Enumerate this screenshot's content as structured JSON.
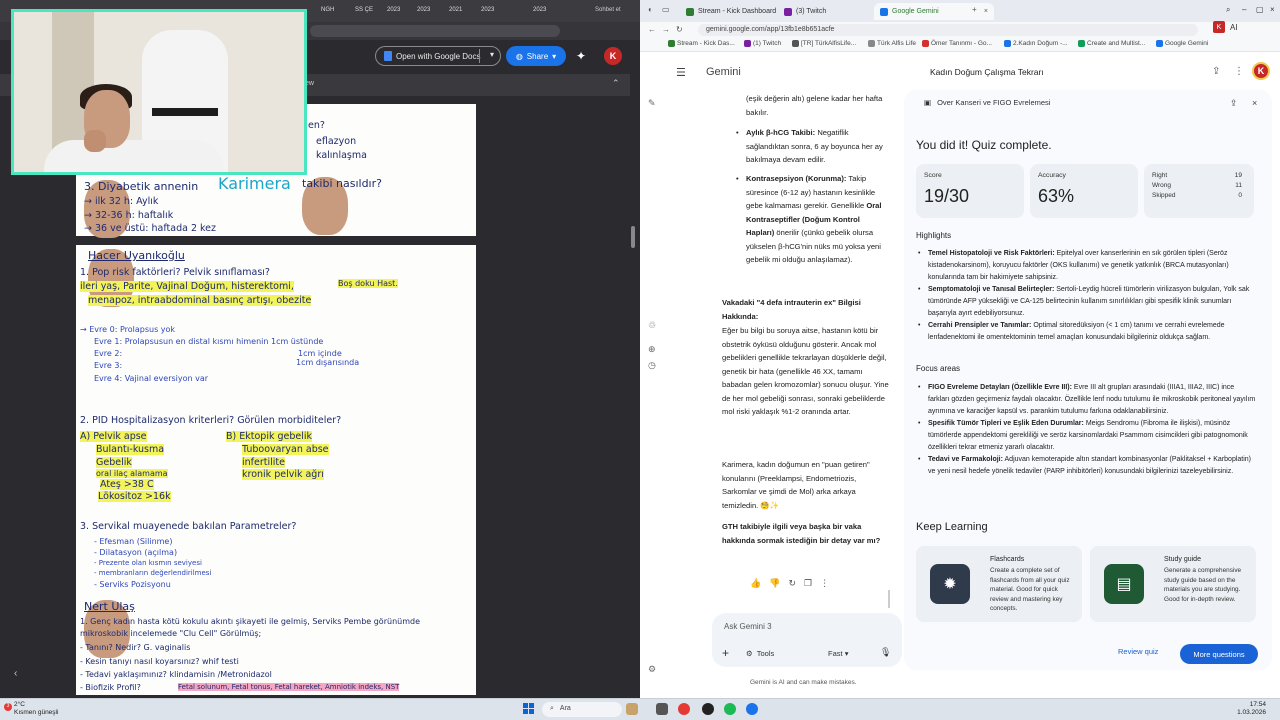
{
  "left": {
    "tabs": [
      "",
      "NGH",
      "SS ÇE",
      "2023",
      "2023",
      "2021",
      "2023",
      "2023"
    ],
    "tab_right": "Sohbet et",
    "toolbar": {
      "open_with": "Open with Google Docs",
      "share": "Share",
      "avatar": "K"
    },
    "pdf_bar_text": "ew",
    "page1_lines": [
      "en?",
      "eflazyon",
      "kalınlaşma",
      "3. Diyabetik annenin",
      "takibi nasıldır?",
      "→ ilk 32 h: Aylık",
      "→ 32-36 h: haftalık",
      "→ 36 ve üstü: haftada 2 kez"
    ],
    "page1_overlay": "Karimera",
    "page2_lines": [
      "Hacer Uyanıkoğlu",
      "1. Pop risk faktörleri? Pelvik sınıflaması?",
      "ileri yaş, Parite, Vajinal Doğum, histerektomi,",
      "Boş doku Hast.",
      "menapoz, intraabdominal basınç artışı, obezite",
      "→ Evre 0: Prolapsus yok",
      "Evre 1: Prolapsusun en distal kısmı himenin 1cm üstünde",
      "Evre 2:",
      "1cm içinde",
      "Evre 3:",
      "1cm dışarısında",
      "Evre 4: Vajinal eversiyon var",
      "2. PID Hospitalizasyon kriterleri? Görülen morbiditeler?",
      "A) Pelvik apse",
      "Bulantı-kusma",
      "Gebelik",
      "oral ilaç alamama",
      "Ateş >38 C",
      "Lökositoz >16k",
      "B) Ektopik gebelik",
      "Tuboovaryan abse",
      "infertilite",
      "kronik pelvik ağrı",
      "3. Servikal muayenede bakılan Parametreler?",
      "- Efesman (Silinme)",
      "- Dilatasyon (açılma)",
      "- Prezente olan kısmın seviyesi",
      "- membranların değerlendirilmesi",
      "- Serviks Pozisyonu",
      "Nert Ulaş",
      "1. Genç kadın hasta kötü kokulu akıntı şikayeti ile gelmiş, Serviks Pembe görünümde",
      "mikroskobik incelemede \"Clu Cell\" Görülmüş;",
      "- Tanını? Nedir? G. vaginalis",
      "- Kesin tanıyı nasıl koyarsınız? whif testi",
      "- Tedavi yaklaşımınız? klindamisin /Metronidazol",
      "- Biofizik Profil?",
      "Fetal solunum, Fetal tonus, Fetal hareket, Amniotik indeks, NST"
    ]
  },
  "right": {
    "tabs": [
      {
        "label": "Stream - Kick Dashboard",
        "color": "#2e7d32"
      },
      {
        "label": "(3) Twitch",
        "color": "#7b1fa2"
      },
      {
        "label": "Google Gemini",
        "color": "#1a73e8"
      }
    ],
    "url": "gemini.google.com/app/13fb1e8b651acfe",
    "bookmarks": [
      "Stream - Kick Das...",
      "(1) Twitch",
      "[TR] TürkAlfisLife...",
      "Türk Alfis Life",
      "Ömer Tanınmı - Go...",
      "2.Kadın Doğum -...",
      "Create and Multist...",
      "Google Gemini"
    ],
    "avatar": "K",
    "ai_label": "AI",
    "gemini_title": "Gemini",
    "conversation_title": "Kadın Doğum Çalışma Tekrarı",
    "chat": {
      "p0": "(eşik değerin altı) gelene kadar her hafta bakılır.",
      "b1_bold": "Aylık β-hCG Takibi:",
      "b1_text": "Negatiflik sağlandıktan sonra, 6 ay boyunca her ay bakılmaya devam edilir.",
      "b2_bold": "Kontrasepsiyon (Korunma):",
      "b2_text": "Takip süresince (6-12 ay) hastanın kesinlikle gebe kalmaması gerekir. Genellikle",
      "b2_bold2": "Oral Kontraseptifler (Doğum Kontrol Hapları)",
      "b2_text2": "önerilir (çünkü gebelik olursa yükselen β-hCG'nin nüks mü yoksa yeni gebelik mi olduğu anlaşılamaz).",
      "h1": "Vakadaki \"4 defa intrauterin ex\" Bilgisi Hakkında:",
      "p1": "Eğer bu bilgi bu soruya aitse, hastanın kötü bir obstetrik öyküsü olduğunu gösterir. Ancak mol gebelikleri genellikle tekrarlayan düşüklerle değil, genetik bir hata (genellikle 46 XX, tamamı babadan gelen kromozomlar) sonucu oluşur. Yine de her mol gebeliği sonrası, sonraki gebeliklerde mol riski yaklaşık %1-2 oranında artar.",
      "p2": "Karimera, kadın doğumun en \"puan getiren\" konularını (Preeklampsi, Endometriozis, Sarkomlar ve şimdi de Mol) arka arkaya temizledin. 🧐✨",
      "q": "GTH takibiyle ilgili veya başka bir vaka hakkında sormak istediğin bir detay var mı?"
    },
    "ask_placeholder": "Ask Gemini 3",
    "tools_label": "Tools",
    "fast_label": "Fast",
    "disclaimer": "Gemini is AI and can make mistakes.",
    "quiz": {
      "panel_title": "Over Kanseri ve FIGO Evrelemesi",
      "complete": "You did it! Quiz complete.",
      "score_label": "Score",
      "score": "19/30",
      "accuracy_label": "Accuracy",
      "accuracy": "63%",
      "right_label": "Right",
      "right": "19",
      "wrong_label": "Wrong",
      "wrong": "11",
      "skipped_label": "Skipped",
      "skipped": "0",
      "highlights_h": "Highlights",
      "highlights": [
        {
          "b": "Temel Histopatoloji ve Risk Faktörleri:",
          "t": "Epitelyal over kanserlerinin en sık görülen tipleri (Seröz kistadenokarsinom), koruyucu faktörler (OKS kullanımı) ve genetik yatkınlık (BRCA mutasyonları) konularında tam bir hakimiyete sahipsiniz."
        },
        {
          "b": "Semptomatoloji ve Tanısal Belirteçler:",
          "t": "Sertoli-Leydig hücreli tümörlerin virilizasyon bulguları, Yolk sak tümöründe AFP yüksekliği ve CA-125 belirtecinin kullanım sınırlılıkları gibi spesifik klinik sunumları başarıyla ayırt edebiliyorsunuz."
        },
        {
          "b": "Cerrahi Prensipler ve Tanımlar:",
          "t": "Optimal sitoredüksiyon (< 1 cm) tanımı ve cerrahi evrelemede lenfadenektomi ile omentektominin temel amaçları konusundaki bilgileriniz oldukça sağlam."
        }
      ],
      "focus_h": "Focus areas",
      "focus": [
        {
          "b": "FIGO Evreleme Detayları (Özellikle Evre III):",
          "t": "Evre III alt grupları arasındaki (IIIA1, IIIA2, IIIC) ince farkları gözden geçirmeniz faydalı olacaktır. Özellikle lenf nodu tutulumu ile mikroskobik peritoneal yayılım ayrımına ve karaciğer kapsül vs. parankim tutulumu farkına odaklanabilirsiniz."
        },
        {
          "b": "Spesifik Tümör Tipleri ve Eşlik Eden Durumlar:",
          "t": "Meigs Sendromu (Fibroma ile ilişkisi), müsinöz tümörlerde appendektomi gerekliliği ve seröz karsinomlardaki Psammom cisimcikleri gibi patognomonik özellikleri tekrar etmeniz yararlı olacaktır."
        },
        {
          "b": "Tedavi ve Farmakoloji:",
          "t": "Adjuvan kemoterapide altın standart kombinasyonlar (Paklitaksel + Karboplatin) ve yeni nesil hedefe yönelik tedaviler (PARP inhibitörleri) konusundaki bilgilerinizi tazeleyebilirsiniz."
        }
      ],
      "keep_h": "Keep Learning",
      "flash_title": "Flashcards",
      "flash_desc": "Create a complete set of flashcards from all your quiz material. Good for quick review and mastering key concepts.",
      "study_title": "Study guide",
      "study_desc": "Generate a comprehensive study guide based on the materials you are studying. Good for in-depth review.",
      "review_btn": "Review quiz",
      "more_btn": "More questions"
    }
  },
  "taskbar": {
    "weather_temp": "2°C",
    "weather_desc": "Kısmen güneşli",
    "search": "Ara",
    "time": "17:54",
    "date": "1.03.2026"
  }
}
